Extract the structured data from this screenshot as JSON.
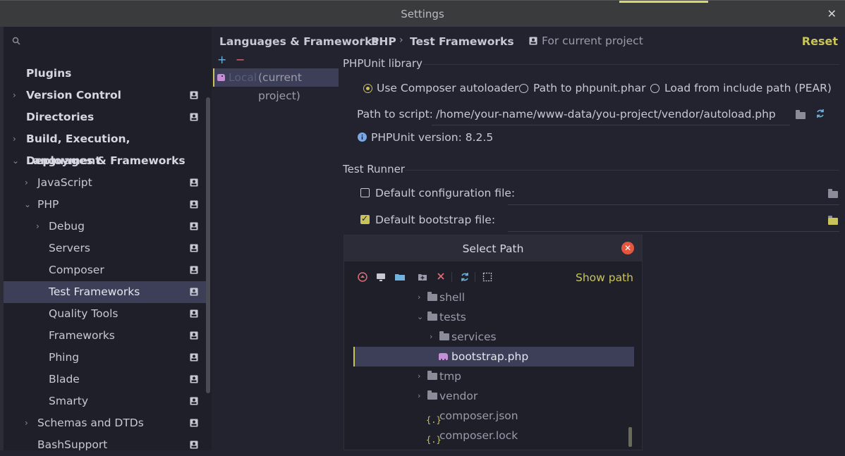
{
  "window": {
    "title": "Settings",
    "close": "✕"
  },
  "sidebar": {
    "search_placeholder": "",
    "items": [
      {
        "label": "Plugins",
        "bold": true
      },
      {
        "label": "Version Control",
        "bold": true
      },
      {
        "label": "Directories",
        "bold": true
      },
      {
        "label": "Build, Execution, Deployment",
        "bold": true
      },
      {
        "label": "Languages & Frameworks",
        "bold": true
      },
      {
        "label": "JavaScript"
      },
      {
        "label": "PHP"
      },
      {
        "label": "Debug"
      },
      {
        "label": "Servers"
      },
      {
        "label": "Composer"
      },
      {
        "label": "Test Frameworks",
        "selected": true
      },
      {
        "label": "Quality Tools"
      },
      {
        "label": "Frameworks"
      },
      {
        "label": "Phing"
      },
      {
        "label": "Blade"
      },
      {
        "label": "Smarty"
      },
      {
        "label": "Schemas and DTDs"
      },
      {
        "label": "BashSupport"
      }
    ]
  },
  "breadcrumb": {
    "items": [
      "Languages & Frameworks",
      "PHP",
      "Test Frameworks"
    ],
    "separator": "›",
    "scope": "For current project"
  },
  "reset_label": "Reset",
  "config_list": {
    "add": "+",
    "remove": "−",
    "item_name": "Local",
    "item_suffix": "(current project)"
  },
  "phpunit": {
    "section_title": "PHPUnit library",
    "options": [
      "Use Composer autoloader",
      "Path to phpunit.phar",
      "Load from include path (PEAR)"
    ],
    "selected_option": "Use Composer autoloader",
    "path_label": "Path to script:",
    "path_value": "/home/your-name/www-data/you-project/vendor/autoload.php",
    "version_text": "PHPUnit version: 8.2.5"
  },
  "test_runner": {
    "section_title": "Test Runner",
    "default_config_label": "Default configuration file:",
    "default_config_checked": false,
    "default_bootstrap_label": "Default bootstrap file:",
    "default_bootstrap_checked": true
  },
  "dialog": {
    "title": "Select Path",
    "show_path": "Show path",
    "tree": [
      {
        "name": "shell",
        "type": "folder",
        "expanded": false
      },
      {
        "name": "tests",
        "type": "folder",
        "expanded": true
      },
      {
        "name": "services",
        "type": "folder",
        "expanded": false
      },
      {
        "name": "bootstrap.php",
        "type": "php",
        "selected": true
      },
      {
        "name": "tmp",
        "type": "folder",
        "expanded": false
      },
      {
        "name": "vendor",
        "type": "folder",
        "expanded": false
      },
      {
        "name": "composer.json",
        "type": "json"
      },
      {
        "name": "composer.lock",
        "type": "json"
      }
    ]
  },
  "colors": {
    "accent": "#c9c45a",
    "selection": "#3d3f58",
    "background": "#22232e",
    "sidebar_bg": "#1e1f29",
    "close_red": "#e8553f"
  }
}
